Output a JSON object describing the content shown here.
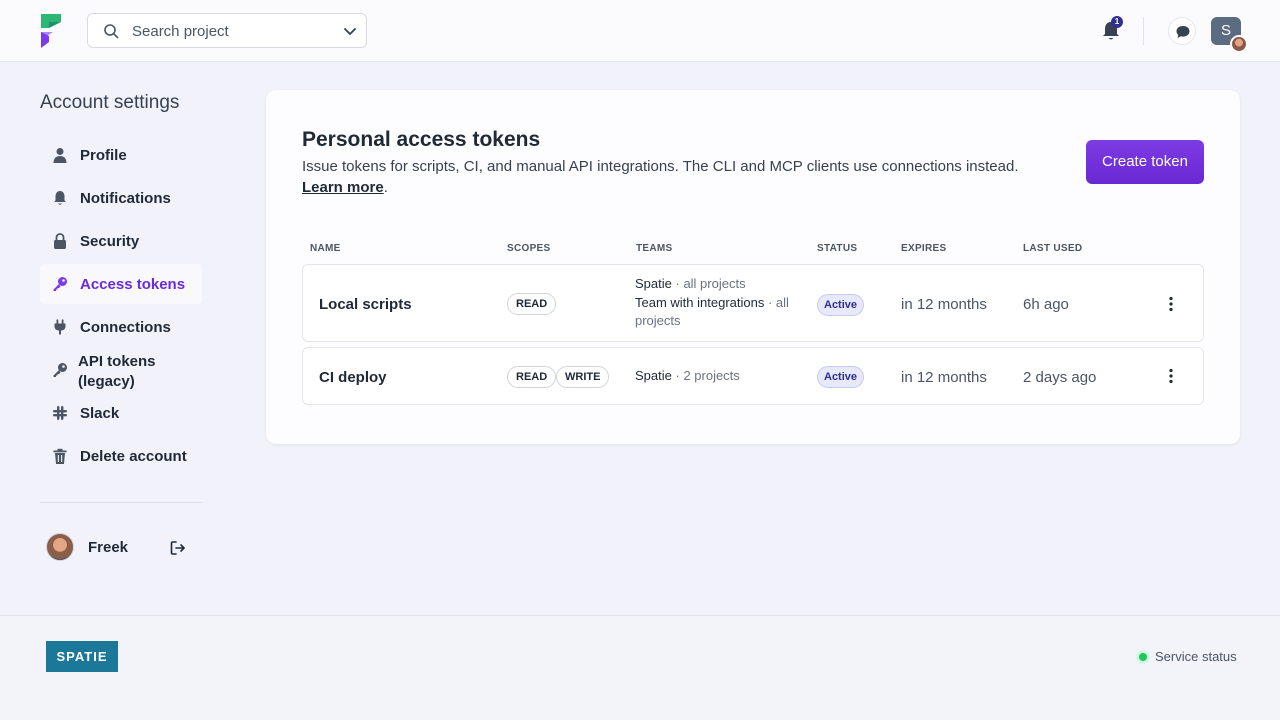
{
  "header": {
    "search_placeholder": "Search project",
    "notification_count": "1",
    "user_initial": "S"
  },
  "sidebar": {
    "title": "Account settings",
    "items": [
      {
        "label": "Profile",
        "icon": "user-icon"
      },
      {
        "label": "Notifications",
        "icon": "bell-icon"
      },
      {
        "label": "Security",
        "icon": "lock-icon"
      },
      {
        "label": "Access tokens",
        "icon": "key-icon",
        "active": true
      },
      {
        "label": "Connections",
        "icon": "plug-icon"
      },
      {
        "label": "API tokens (legacy)",
        "icon": "key-icon"
      },
      {
        "label": "Slack",
        "icon": "slack-icon"
      },
      {
        "label": "Delete account",
        "icon": "trash-icon"
      }
    ],
    "user_name": "Freek"
  },
  "card": {
    "title": "Personal access tokens",
    "description": "Issue tokens for scripts, CI, and manual API integrations. The CLI and MCP clients use connections instead.",
    "learn_more": "Learn more",
    "create_button": "Create token",
    "columns": [
      "NAME",
      "SCOPES",
      "TEAMS",
      "STATUS",
      "EXPIRES",
      "LAST USED"
    ],
    "rows": [
      {
        "name": "Local scripts",
        "scopes": [
          "READ"
        ],
        "teams": [
          {
            "team": "Spatie",
            "scope": "all projects"
          },
          {
            "team": "Team with integrations",
            "scope": "all projects"
          }
        ],
        "status": "Active",
        "expires": "in 12 months",
        "last_used": "6h ago"
      },
      {
        "name": "CI deploy",
        "scopes": [
          "READ",
          "WRITE"
        ],
        "teams": [
          {
            "team": "Spatie",
            "scope": "2 projects"
          }
        ],
        "status": "Active",
        "expires": "in 12 months",
        "last_used": "2 days ago"
      }
    ]
  },
  "footer": {
    "brand": "SPATIE",
    "service_status": "Service status"
  },
  "colors": {
    "accent": "#6a28d3",
    "active_nav": "#6b2bd9",
    "status_ok": "#22c55e",
    "brand_bg": "#1c7899"
  }
}
